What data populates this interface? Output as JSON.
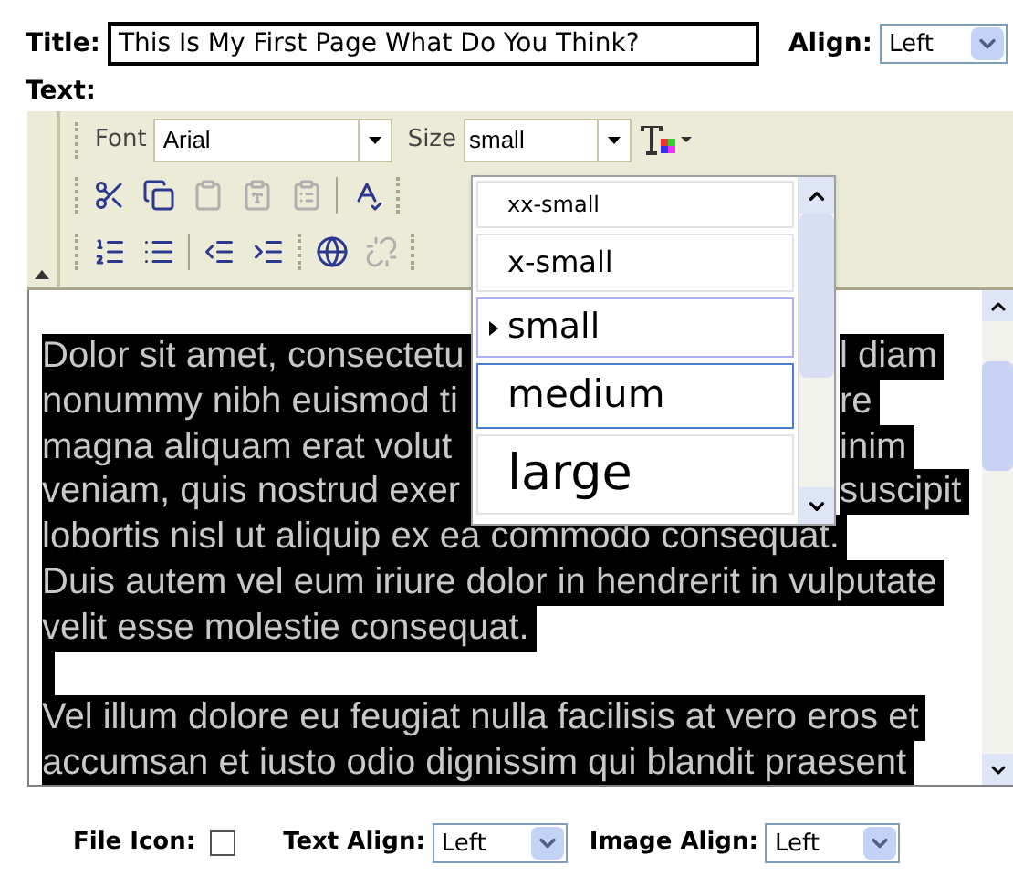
{
  "title_field": {
    "label": "Title:",
    "value": "This Is My First Page What Do You Think?"
  },
  "align": {
    "label": "Align:",
    "value": "Left"
  },
  "text_label": "Text:",
  "toolbar": {
    "font_label": "Font",
    "font_value": "Arial",
    "size_label": "Size",
    "size_value": "small"
  },
  "size_dropdown": {
    "options": [
      {
        "label": "xx-small",
        "selected": false,
        "highlighted": false
      },
      {
        "label": "x-small",
        "selected": false,
        "highlighted": false
      },
      {
        "label": "small",
        "selected": true,
        "highlighted": false
      },
      {
        "label": "medium",
        "selected": false,
        "highlighted": true
      },
      {
        "label": "large",
        "selected": false,
        "highlighted": false
      }
    ]
  },
  "editor": {
    "lines": [
      {
        "left": "Dolor sit amet, consectetu",
        "right": "l diam"
      },
      {
        "left": "nonummy nibh euismod ti",
        "right": "re"
      },
      {
        "left": "magna aliquam erat volut",
        "right": "inim"
      },
      {
        "left": "veniam, quis nostrud exer",
        "right": "suscipit"
      },
      {
        "left": "lobortis nisl ut aliquip ex ea commodo consequat."
      },
      {
        "left": "Duis autem vel eum iriure dolor in hendrerit in vulputate"
      },
      {
        "left": "velit esse molestie consequat."
      },
      {
        "kind": "blank"
      },
      {
        "left": "Vel illum dolore eu feugiat nulla facilisis at vero eros et"
      },
      {
        "left": "accumsan et iusto odio dignissim qui blandit praesent"
      }
    ]
  },
  "bottom": {
    "file_icon_label": "File Icon:",
    "file_icon_checked": false,
    "text_align_label": "Text Align:",
    "text_align_value": "Left",
    "image_align_label": "Image Align:",
    "image_align_value": "Left"
  }
}
